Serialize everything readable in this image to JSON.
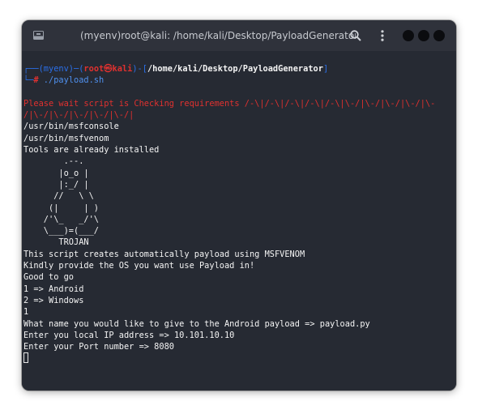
{
  "window": {
    "title": "(myenv)root@kali: /home/kali/Desktop/PayloadGenerator"
  },
  "prompt": {
    "corner_top": "┌──",
    "env": "(myenv)",
    "dash1": "─",
    "user_open": "(",
    "user": "root",
    "skull": "㉿",
    "host": "kali",
    "user_close": ")",
    "dash2": "-",
    "path_open": "[",
    "path": "/home/kali/Desktop/PayloadGenerator",
    "path_close": "]",
    "corner_bottom": "└─",
    "hash": "#",
    "command": " ./payload.sh"
  },
  "output": {
    "wait_line1": "Please wait script is Checking requirements /-\\|/-\\|/-\\|/-\\|/-\\|\\-/|\\-/|\\-/|\\-/|\\-",
    "wait_line2": "/|\\-/|\\-/|\\-/|\\-/|\\-/|",
    "msfconsole": "/usr/bin/msfconsole",
    "msfvenom": "/usr/bin/msfvenom",
    "installed": "Tools are already installed",
    "ascii_art": "        .--.\n       |o_o |\n       |:_/ |\n      //   \\ \\\n     (|     | )\n    /'\\_   _/'\\\n    \\___)=(___/\n       TROJAN",
    "intro1": "This script creates automatically payload using MSFVENOM",
    "intro2": "Kindly provide the OS you want use Payload in!",
    "good": "Good to go",
    "opt1": "1 => Android",
    "opt2": "2 => Windows",
    "choice": "1",
    "name_q": "What name you would like to give to the Android payload => payload.py",
    "ip_q": "Enter you local IP address => 10.101.10.10",
    "port_q": "Enter your Port number => 8080"
  },
  "colors": {
    "window_bg": "#262a33",
    "titlebar_bg": "#2f323b",
    "prompt_blue": "#2b6fe8",
    "root_red": "#e0312f",
    "text": "#f4f4f4"
  },
  "icons": {
    "app": "terminal-app-icon",
    "search": "search-icon",
    "menu": "kebab-menu-icon"
  }
}
